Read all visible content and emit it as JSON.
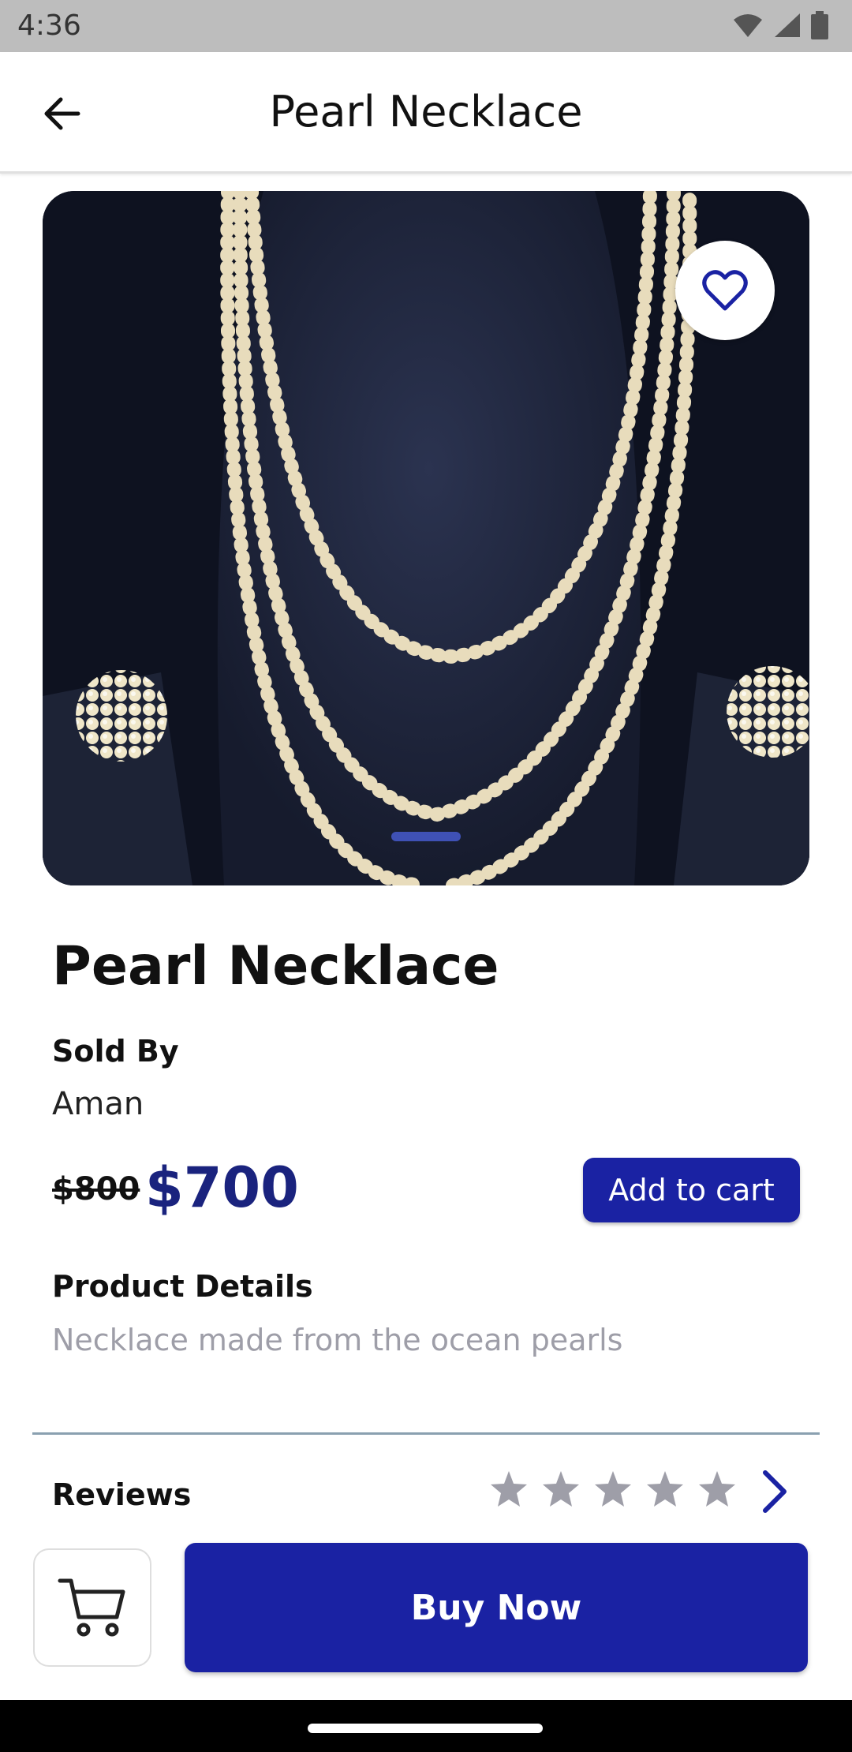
{
  "status_bar": {
    "time": "4:36",
    "icons": [
      "wifi-icon",
      "signal-icon",
      "battery-icon"
    ]
  },
  "app_bar": {
    "title": "Pearl Necklace",
    "back_icon": "arrow-back-icon"
  },
  "hero": {
    "image_subject": "pearl necklace",
    "favorite_icon": "heart-outline-icon",
    "pages": 1,
    "active_page": 1
  },
  "product": {
    "name": "Pearl Necklace",
    "sold_by_label": "Sold By",
    "seller": "Aman",
    "old_price": "$800",
    "price": "$700",
    "add_to_cart_label": "Add to cart",
    "details_label": "Product Details",
    "details_text": "Necklace made from the ocean pearls"
  },
  "reviews": {
    "label": "Reviews",
    "rating": 0,
    "max_rating": 5,
    "chevron_icon": "chevron-right-icon"
  },
  "bottom": {
    "cart_icon": "cart-icon",
    "buy_now_label": "Buy Now"
  },
  "colors": {
    "primary": "#1a22a3",
    "price": "#1a237e",
    "star_inactive": "#9e9ea8",
    "muted_text": "#9e9ea8"
  }
}
